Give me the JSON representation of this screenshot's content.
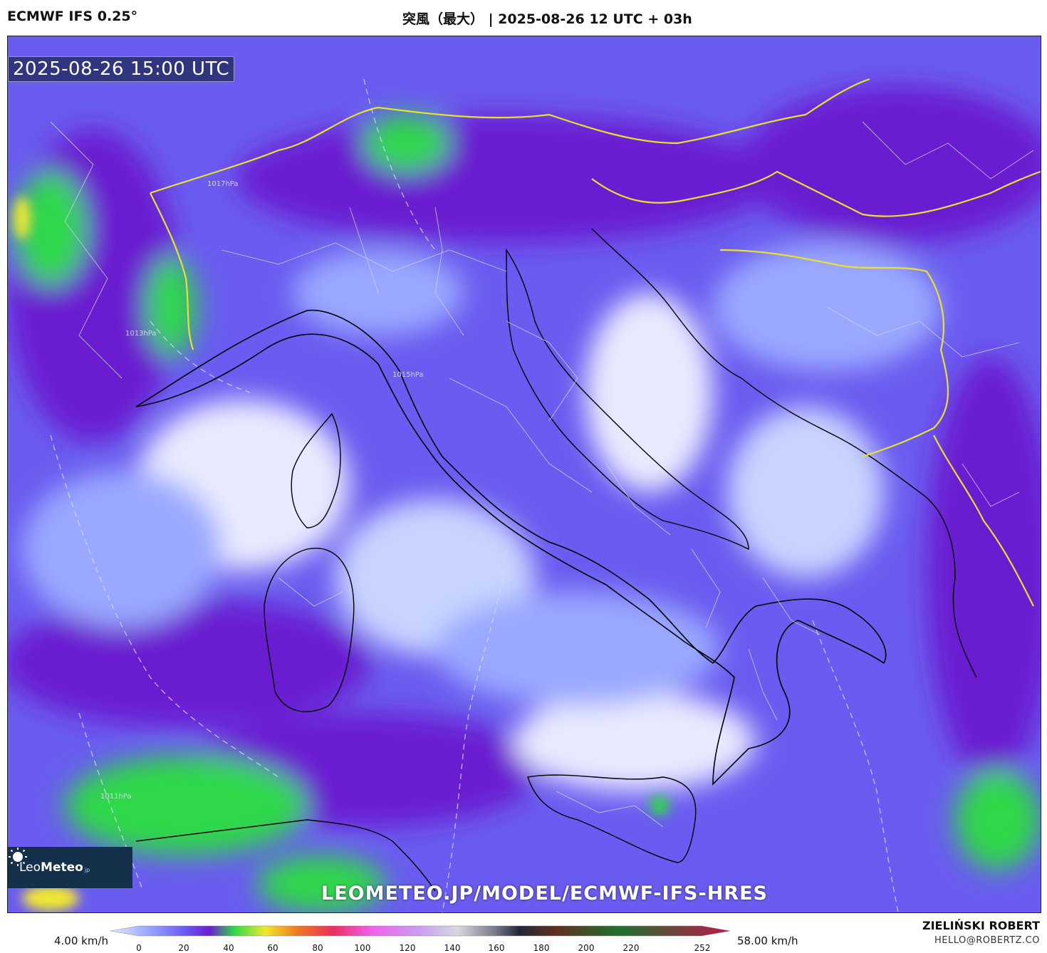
{
  "header": {
    "model": "ECMWF IFS 0.25°",
    "title": "突風（最大） | 2025-08-26 12 UTC + 03h"
  },
  "map": {
    "valid_time": "2025-08-26 15:00 UTC",
    "url": "LEOMETEO.JP/MODEL/ECMWF-IFS-HRES",
    "isobar_labels": [
      "1017hPa",
      "1015hPa",
      "1013hPa",
      "1011hPa"
    ]
  },
  "logo": {
    "name_light": "Leo",
    "name_bold": "Meteo",
    "suffix": "jp"
  },
  "legend": {
    "min_label": "4.00 km/h",
    "max_label": "58.00 km/h",
    "ticks": [
      "0",
      "20",
      "40",
      "60",
      "80",
      "100",
      "120",
      "140",
      "160",
      "180",
      "200",
      "220",
      "252"
    ],
    "colors": [
      "#e8eaff",
      "#9aa8ff",
      "#6a5cf0",
      "#6a1fd0",
      "#2fd84a",
      "#f0e830",
      "#f07a20",
      "#e83060",
      "#f060e8",
      "#c8a0f0",
      "#d8d8e0",
      "#7a7a8a",
      "#202838",
      "#603020",
      "#207030",
      "#c01848"
    ]
  },
  "footer": {
    "author": "ZIELIŃSKI ROBERT",
    "contact": "HELLO@ROBERTZ.CO"
  }
}
